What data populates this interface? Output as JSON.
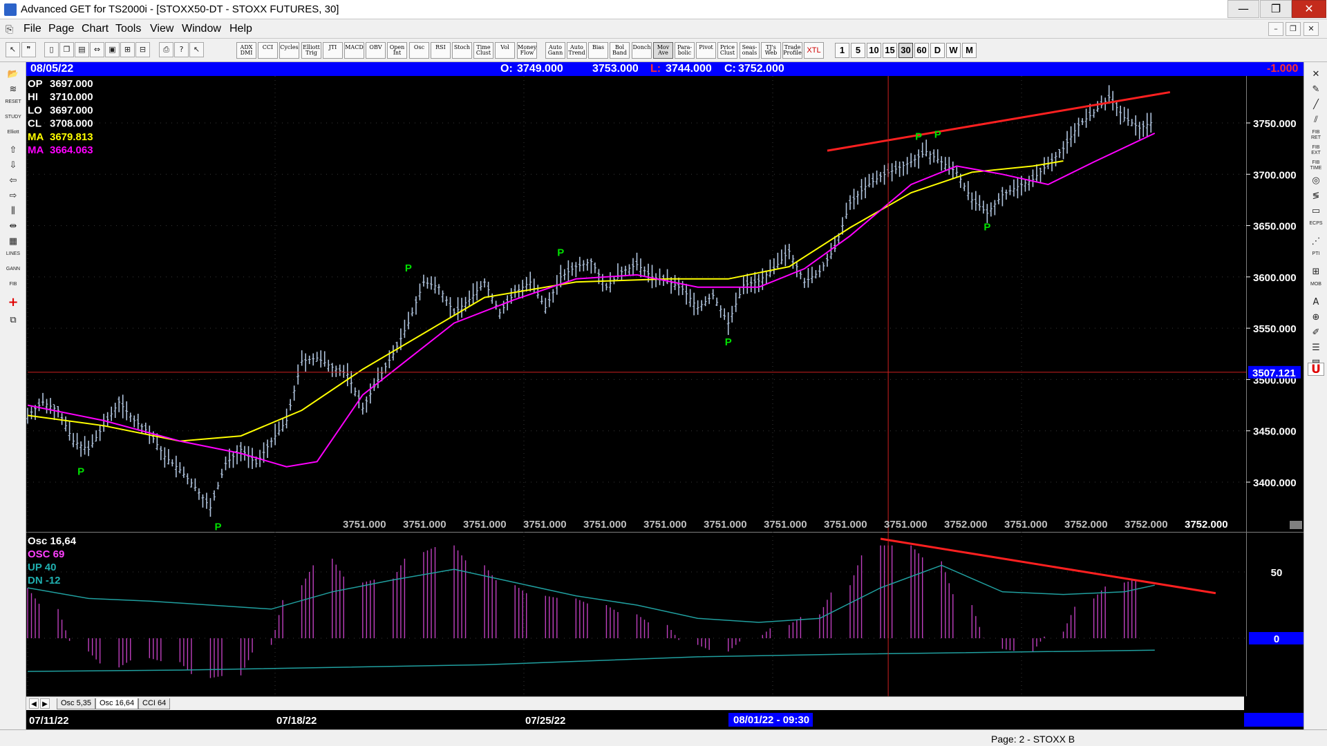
{
  "window": {
    "title": "Advanced GET for TS2000i - [STOXX50-DT - STOXX FUTURES, 30]",
    "minimize_glyph": "—",
    "maximize_glyph": "❐",
    "close_glyph": "✕"
  },
  "menu": {
    "items": [
      "File",
      "Page",
      "Chart",
      "Tools",
      "View",
      "Window",
      "Help"
    ],
    "mdi_minimize": "–",
    "mdi_restore": "❐",
    "mdi_close": "✕"
  },
  "toolbar": {
    "indicators": [
      {
        "line1": "ADX",
        "line2": "DMI"
      },
      {
        "line1": "CCI",
        "line2": ""
      },
      {
        "line1": "Cycles",
        "line2": ""
      },
      {
        "line1": "Elliott",
        "line2": "Trig"
      },
      {
        "line1": "JTI",
        "line2": ""
      },
      {
        "line1": "MACD",
        "line2": ""
      },
      {
        "line1": "OBV",
        "line2": ""
      },
      {
        "line1": "Open",
        "line2": "Int"
      },
      {
        "line1": "Osc",
        "line2": ""
      },
      {
        "line1": "RSI",
        "line2": ""
      },
      {
        "line1": "Stoch",
        "line2": ""
      },
      {
        "line1": "Time",
        "line2": "Clust"
      },
      {
        "line1": "Vol",
        "line2": ""
      },
      {
        "line1": "Money",
        "line2": "Flow"
      },
      {
        "line1": "Auto",
        "line2": "Gann"
      },
      {
        "line1": "Auto",
        "line2": "Trend"
      },
      {
        "line1": "Bias",
        "line2": ""
      },
      {
        "line1": "Bol",
        "line2": "Band"
      },
      {
        "line1": "Donch",
        "line2": ""
      },
      {
        "line1": "Mov",
        "line2": "Ave"
      },
      {
        "line1": "Para-",
        "line2": "bolic"
      },
      {
        "line1": "Pivot",
        "line2": ""
      },
      {
        "line1": "Price",
        "line2": "Clust"
      },
      {
        "line1": "Seas-",
        "line2": "onals"
      },
      {
        "line1": "TJ's",
        "line2": "Web"
      },
      {
        "line1": "Trade",
        "line2": "Profile"
      },
      {
        "line1": "XTL",
        "line2": ""
      }
    ],
    "timeframes": [
      "1",
      "5",
      "10",
      "15",
      "30",
      "60",
      "D",
      "W",
      "M"
    ],
    "active_timeframe": "30"
  },
  "header": {
    "date": "08/05/22",
    "open_label": "O:",
    "open": "3749.000",
    "high": "3753.000",
    "low_label": "L:",
    "low": "3744.000",
    "close_label": "C:",
    "close": "3752.000",
    "change": "-1.000"
  },
  "price_legend": [
    {
      "label": "OP",
      "value": "3697.000",
      "color": "#ffffff"
    },
    {
      "label": "HI",
      "value": "3710.000",
      "color": "#ffffff"
    },
    {
      "label": "LO",
      "value": "3697.000",
      "color": "#ffffff"
    },
    {
      "label": "CL",
      "value": "3708.000",
      "color": "#ffffff"
    },
    {
      "label": "MA",
      "value": "3679.813",
      "color": "#ffff00"
    },
    {
      "label": "MA",
      "value": "3664.063",
      "color": "#ff00ff"
    }
  ],
  "price_axis": {
    "ticks": [
      "3750.000",
      "3700.000",
      "3650.000",
      "3600.000",
      "3550.000",
      "3500.000",
      "3450.000",
      "3400.000"
    ],
    "cursor_value": "3507.121"
  },
  "bottom_price_labels": [
    "3751.000",
    "3751.000",
    "3751.000",
    "3751.000",
    "3751.000",
    "3751.000",
    "3751.000",
    "3751.000",
    "3751.000",
    "3751.000",
    "3752.000",
    "3751.000",
    "3752.000",
    "3752.000"
  ],
  "last_price_label": "3752.000",
  "pivot_label": "P",
  "osc_legend": [
    {
      "text": "Osc 16,64",
      "color": "#ffffff"
    },
    {
      "text": "OSC 69",
      "color": "#ff40ff"
    },
    {
      "text": "UP   40",
      "color": "#20b0b0"
    },
    {
      "text": "DN   -12",
      "color": "#20b0b0"
    }
  ],
  "osc_axis": {
    "ticks": [
      "50",
      "0"
    ]
  },
  "tabs": [
    "Osc 5,35",
    "Osc 16,64",
    "CCI 64"
  ],
  "active_tab": "Osc 16,64",
  "date_axis": {
    "labels": [
      "07/11/22",
      "07/18/22",
      "07/25/22"
    ],
    "cursor": "08/01/22 - 09:30"
  },
  "status": {
    "text": "Page: 2 - STOXX B"
  },
  "colors": {
    "background": "#000000",
    "price_bars": "#b0c4de",
    "ma_fast": "#ffff00",
    "ma_slow": "#ff00ff",
    "trendline": "#ff2020",
    "pivot": "#00e000",
    "osc_bars": "#c040c0",
    "osc_signal": "#20a0a0",
    "header_bar": "#0000ff"
  },
  "chart_data": {
    "type": "line",
    "x_dates": [
      "07/11/22",
      "07/18/22",
      "07/25/22",
      "08/01/22"
    ],
    "ylim": [
      3370,
      3785
    ],
    "price_series": [
      {
        "t": 0,
        "c": 3465
      },
      {
        "t": 4,
        "c": 3478
      },
      {
        "t": 8,
        "c": 3470
      },
      {
        "t": 12,
        "c": 3440
      },
      {
        "t": 16,
        "c": 3432
      },
      {
        "t": 20,
        "c": 3455
      },
      {
        "t": 24,
        "c": 3478
      },
      {
        "t": 28,
        "c": 3460
      },
      {
        "t": 32,
        "c": 3448
      },
      {
        "t": 36,
        "c": 3425
      },
      {
        "t": 40,
        "c": 3412
      },
      {
        "t": 44,
        "c": 3395
      },
      {
        "t": 48,
        "c": 3375
      },
      {
        "t": 52,
        "c": 3418
      },
      {
        "t": 56,
        "c": 3432
      },
      {
        "t": 60,
        "c": 3418
      },
      {
        "t": 64,
        "c": 3440
      },
      {
        "t": 68,
        "c": 3460
      },
      {
        "t": 72,
        "c": 3518
      },
      {
        "t": 76,
        "c": 3521
      },
      {
        "t": 80,
        "c": 3512
      },
      {
        "t": 84,
        "c": 3505
      },
      {
        "t": 88,
        "c": 3472
      },
      {
        "t": 92,
        "c": 3500
      },
      {
        "t": 96,
        "c": 3525
      },
      {
        "t": 100,
        "c": 3555
      },
      {
        "t": 104,
        "c": 3595
      },
      {
        "t": 108,
        "c": 3590
      },
      {
        "t": 112,
        "c": 3565
      },
      {
        "t": 116,
        "c": 3578
      },
      {
        "t": 120,
        "c": 3595
      },
      {
        "t": 124,
        "c": 3565
      },
      {
        "t": 128,
        "c": 3585
      },
      {
        "t": 132,
        "c": 3595
      },
      {
        "t": 136,
        "c": 3570
      },
      {
        "t": 140,
        "c": 3600
      },
      {
        "t": 144,
        "c": 3610
      },
      {
        "t": 148,
        "c": 3615
      },
      {
        "t": 152,
        "c": 3590
      },
      {
        "t": 156,
        "c": 3605
      },
      {
        "t": 160,
        "c": 3612
      },
      {
        "t": 164,
        "c": 3600
      },
      {
        "t": 168,
        "c": 3596
      },
      {
        "t": 172,
        "c": 3588
      },
      {
        "t": 176,
        "c": 3570
      },
      {
        "t": 180,
        "c": 3582
      },
      {
        "t": 184,
        "c": 3555
      },
      {
        "t": 188,
        "c": 3592
      },
      {
        "t": 192,
        "c": 3596
      },
      {
        "t": 196,
        "c": 3608
      },
      {
        "t": 200,
        "c": 3625
      },
      {
        "t": 204,
        "c": 3595
      },
      {
        "t": 208,
        "c": 3605
      },
      {
        "t": 212,
        "c": 3628
      },
      {
        "t": 216,
        "c": 3672
      },
      {
        "t": 220,
        "c": 3688
      },
      {
        "t": 224,
        "c": 3698
      },
      {
        "t": 228,
        "c": 3705
      },
      {
        "t": 232,
        "c": 3712
      },
      {
        "t": 236,
        "c": 3722
      },
      {
        "t": 240,
        "c": 3712
      },
      {
        "t": 244,
        "c": 3702
      },
      {
        "t": 248,
        "c": 3675
      },
      {
        "t": 252,
        "c": 3662
      },
      {
        "t": 256,
        "c": 3680
      },
      {
        "t": 260,
        "c": 3688
      },
      {
        "t": 264,
        "c": 3695
      },
      {
        "t": 268,
        "c": 3710
      },
      {
        "t": 272,
        "c": 3725
      },
      {
        "t": 276,
        "c": 3748
      },
      {
        "t": 280,
        "c": 3760
      },
      {
        "t": 284,
        "c": 3775
      },
      {
        "t": 288,
        "c": 3755
      },
      {
        "t": 292,
        "c": 3745
      },
      {
        "t": 296,
        "c": 3752
      }
    ],
    "ma_fast": [
      {
        "t": 0,
        "v": 3465
      },
      {
        "t": 20,
        "v": 3455
      },
      {
        "t": 40,
        "v": 3440
      },
      {
        "t": 56,
        "v": 3445
      },
      {
        "t": 72,
        "v": 3470
      },
      {
        "t": 88,
        "v": 3510
      },
      {
        "t": 104,
        "v": 3545
      },
      {
        "t": 120,
        "v": 3580
      },
      {
        "t": 144,
        "v": 3595
      },
      {
        "t": 168,
        "v": 3598
      },
      {
        "t": 184,
        "v": 3598
      },
      {
        "t": 200,
        "v": 3610
      },
      {
        "t": 216,
        "v": 3648
      },
      {
        "t": 232,
        "v": 3682
      },
      {
        "t": 248,
        "v": 3702
      },
      {
        "t": 264,
        "v": 3708
      },
      {
        "t": 272,
        "v": 3713
      }
    ],
    "ma_slow": [
      {
        "t": 0,
        "v": 3475
      },
      {
        "t": 20,
        "v": 3460
      },
      {
        "t": 40,
        "v": 3440
      },
      {
        "t": 56,
        "v": 3428
      },
      {
        "t": 68,
        "v": 3415
      },
      {
        "t": 76,
        "v": 3420
      },
      {
        "t": 88,
        "v": 3485
      },
      {
        "t": 100,
        "v": 3520
      },
      {
        "t": 112,
        "v": 3555
      },
      {
        "t": 128,
        "v": 3578
      },
      {
        "t": 144,
        "v": 3598
      },
      {
        "t": 160,
        "v": 3602
      },
      {
        "t": 176,
        "v": 3590
      },
      {
        "t": 192,
        "v": 3590
      },
      {
        "t": 204,
        "v": 3608
      },
      {
        "t": 216,
        "v": 3640
      },
      {
        "t": 232,
        "v": 3690
      },
      {
        "t": 244,
        "v": 3708
      },
      {
        "t": 256,
        "v": 3700
      },
      {
        "t": 268,
        "v": 3690
      },
      {
        "t": 280,
        "v": 3712
      },
      {
        "t": 296,
        "v": 3740
      }
    ],
    "pivots_high": [
      {
        "t": 100,
        "v": 3600
      },
      {
        "t": 140,
        "v": 3615
      },
      {
        "t": 234,
        "v": 3728
      },
      {
        "t": 239,
        "v": 3730
      }
    ],
    "pivots_low": [
      {
        "t": 14,
        "v": 3422
      },
      {
        "t": 50,
        "v": 3368
      },
      {
        "t": 184,
        "v": 3548
      },
      {
        "t": 252,
        "v": 3660
      }
    ],
    "trendlines_price": [
      {
        "t1": 210,
        "v1": 3723,
        "t2": 300,
        "v2": 3780
      }
    ],
    "osc_ylim": [
      -40,
      80
    ],
    "osc": [
      {
        "t": 0,
        "v": 38
      },
      {
        "t": 8,
        "v": 22
      },
      {
        "t": 16,
        "v": -10
      },
      {
        "t": 24,
        "v": -22
      },
      {
        "t": 32,
        "v": -15
      },
      {
        "t": 40,
        "v": -18
      },
      {
        "t": 48,
        "v": -30
      },
      {
        "t": 56,
        "v": -28
      },
      {
        "t": 64,
        "v": -5
      },
      {
        "t": 72,
        "v": 40
      },
      {
        "t": 80,
        "v": 60
      },
      {
        "t": 88,
        "v": 42
      },
      {
        "t": 96,
        "v": 45
      },
      {
        "t": 104,
        "v": 65
      },
      {
        "t": 112,
        "v": 70
      },
      {
        "t": 120,
        "v": 55
      },
      {
        "t": 128,
        "v": 40
      },
      {
        "t": 136,
        "v": 32
      },
      {
        "t": 144,
        "v": 30
      },
      {
        "t": 152,
        "v": 25
      },
      {
        "t": 160,
        "v": 18
      },
      {
        "t": 168,
        "v": 10
      },
      {
        "t": 176,
        "v": -5
      },
      {
        "t": 184,
        "v": -10
      },
      {
        "t": 192,
        "v": 0
      },
      {
        "t": 200,
        "v": 10
      },
      {
        "t": 208,
        "v": 18
      },
      {
        "t": 216,
        "v": 40
      },
      {
        "t": 224,
        "v": 70
      },
      {
        "t": 232,
        "v": 70
      },
      {
        "t": 240,
        "v": 58
      },
      {
        "t": 248,
        "v": 25
      },
      {
        "t": 256,
        "v": -8
      },
      {
        "t": 264,
        "v": -10
      },
      {
        "t": 272,
        "v": 5
      },
      {
        "t": 280,
        "v": 30
      },
      {
        "t": 288,
        "v": 42
      },
      {
        "t": 296,
        "v": 45
      }
    ],
    "osc_signal": [
      {
        "t": 0,
        "v": 38
      },
      {
        "t": 16,
        "v": 30
      },
      {
        "t": 32,
        "v": 28
      },
      {
        "t": 48,
        "v": 25
      },
      {
        "t": 64,
        "v": 22
      },
      {
        "t": 80,
        "v": 35
      },
      {
        "t": 96,
        "v": 44
      },
      {
        "t": 112,
        "v": 52
      },
      {
        "t": 128,
        "v": 42
      },
      {
        "t": 144,
        "v": 32
      },
      {
        "t": 160,
        "v": 25
      },
      {
        "t": 176,
        "v": 15
      },
      {
        "t": 192,
        "v": 12
      },
      {
        "t": 208,
        "v": 15
      },
      {
        "t": 224,
        "v": 38
      },
      {
        "t": 240,
        "v": 55
      },
      {
        "t": 256,
        "v": 35
      },
      {
        "t": 272,
        "v": 33
      },
      {
        "t": 288,
        "v": 35
      },
      {
        "t": 296,
        "v": 40
      }
    ],
    "osc_lower_band": [
      {
        "t": 0,
        "v": -25
      },
      {
        "t": 40,
        "v": -24
      },
      {
        "t": 80,
        "v": -22
      },
      {
        "t": 120,
        "v": -20
      },
      {
        "t": 176,
        "v": -14
      },
      {
        "t": 216,
        "v": -12
      },
      {
        "t": 296,
        "v": -9
      }
    ],
    "trendlines_osc": [
      {
        "t1": 224,
        "v1": 75,
        "t2": 312,
        "v2": 34
      }
    ],
    "cursor_t": 226,
    "cursor_price": 3507.121
  }
}
